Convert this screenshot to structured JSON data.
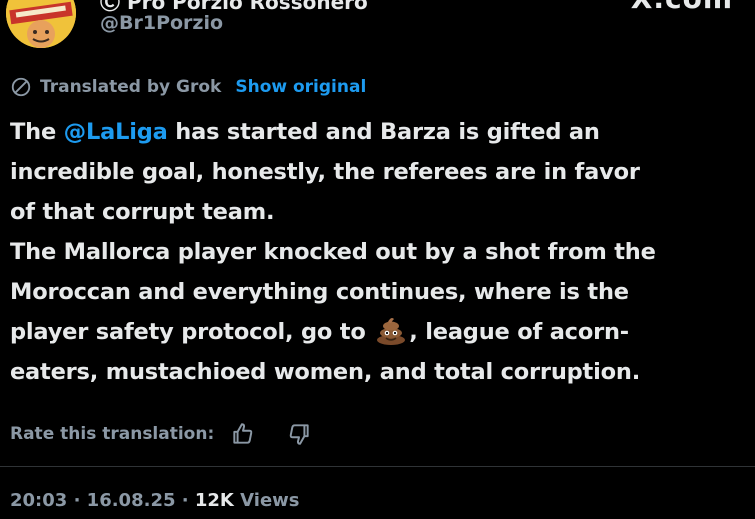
{
  "header": {
    "display_name": "Ⓒ Pro Porzio Rossonero",
    "handle": "@Br1Porzio",
    "watermark": "X.com"
  },
  "translation": {
    "translated_by": "Translated by Grok",
    "show_original": "Show original"
  },
  "tweet": {
    "line1_pre": "The ",
    "line1_mention": "@LaLiga",
    "line1_post": " has started and Barza is gifted an",
    "line2": "incredible goal, honestly, the referees are in favor",
    "line3": "of that corrupt team.",
    "line4": "The Mallorca player knocked out by a shot from the",
    "line5": "Moroccan and everything continues, where is the",
    "line6_pre": "player safety protocol, go to ",
    "line6_post": ", league of acorn-",
    "line7": "eaters, mustachioed women, and total corruption.",
    "emoji": "poop-emoji"
  },
  "rate": {
    "label": "Rate this translation:",
    "thumbs_up_icon": "thumbs-up-icon",
    "thumbs_down_icon": "thumbs-down-icon"
  },
  "meta": {
    "time": "20:03",
    "separator": " · ",
    "date": "16.08.25",
    "views_count": "12K",
    "views_label": "Views"
  },
  "colors": {
    "background": "#000000",
    "text": "#e7e9ea",
    "muted": "#8b98a5",
    "link": "#1d9bf0"
  }
}
